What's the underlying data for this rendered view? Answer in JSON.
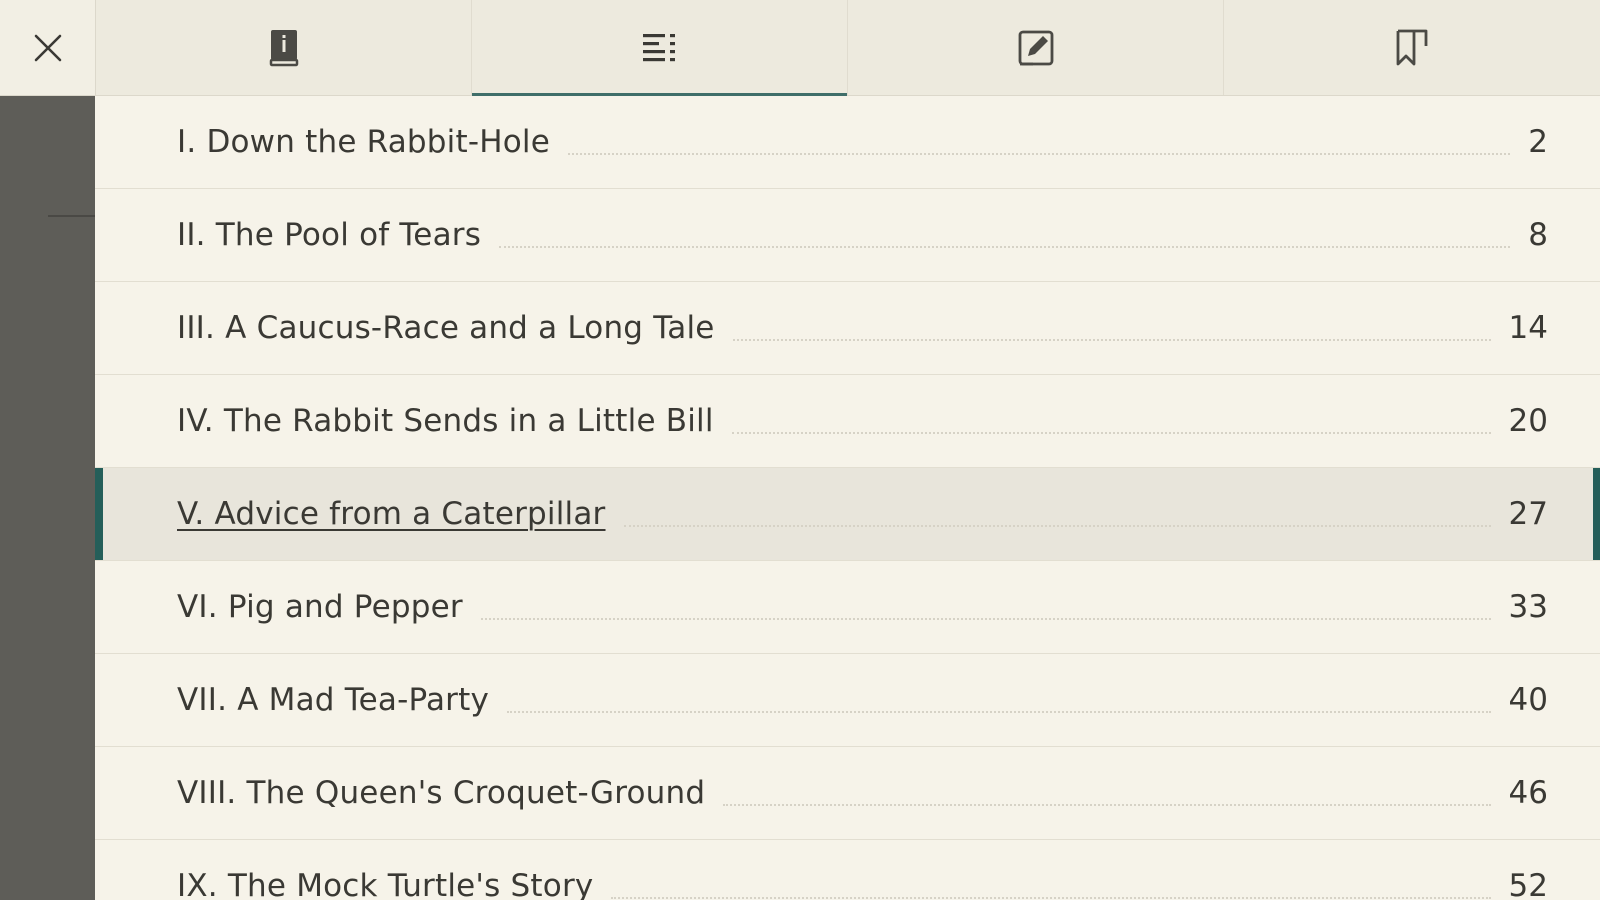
{
  "tabs": [
    {
      "name": "tab-book-info",
      "icon": "book-info-icon",
      "active": false
    },
    {
      "name": "tab-contents",
      "icon": "list-icon",
      "active": true
    },
    {
      "name": "tab-notes",
      "icon": "note-edit-icon",
      "active": false
    },
    {
      "name": "tab-bookmarks",
      "icon": "bookmark-icon",
      "active": false
    }
  ],
  "close_icon": "close-icon",
  "toc": [
    {
      "title": "I. Down the Rabbit-Hole",
      "page": "2"
    },
    {
      "title": "II. The Pool of Tears",
      "page": "8"
    },
    {
      "title": "III. A Caucus-Race and a Long Tale",
      "page": "14"
    },
    {
      "title": "IV. The Rabbit Sends in a Little Bill",
      "page": "20"
    },
    {
      "title": "V. Advice from a Caterpillar",
      "page": "27",
      "current": true
    },
    {
      "title": "VI. Pig and Pepper",
      "page": "33"
    },
    {
      "title": "VII. A Mad Tea-Party",
      "page": "40"
    },
    {
      "title": "VIII. The Queen's Croquet-Ground",
      "page": "46"
    },
    {
      "title": "IX. The Mock Turtle's Story",
      "page": "52"
    }
  ],
  "colors": {
    "accent": "#245e59",
    "panel_bg": "#f6f3e9",
    "topbar_bg": "#edeade",
    "text": "#3a3934"
  }
}
